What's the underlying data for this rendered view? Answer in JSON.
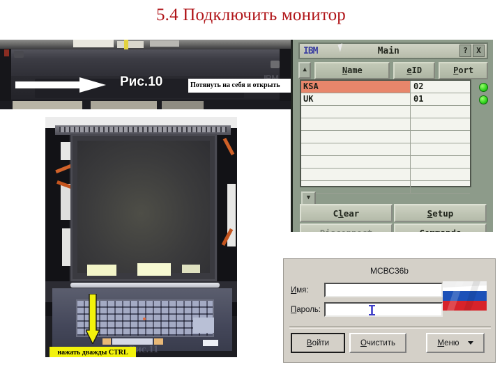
{
  "slide": {
    "title": "5.4 Подключить монитор",
    "title_color": "#b01418"
  },
  "photo_rack": {
    "figure_label": "Рис.10",
    "caption": "Потянуть на себя и открыть",
    "brand_text": "IBM",
    "arrow": "white-right-arrow"
  },
  "photo_monitor": {
    "caption": "нажать дважды CTRL",
    "caption_bg": "#f2f20c",
    "arrow": "yellow-down-arrow",
    "figure_label": "Рис.11"
  },
  "kvm_window": {
    "brand": "IBM",
    "title": "Main",
    "help_button": "?",
    "close_button": "X",
    "scroll_up": "▲",
    "scroll_down": "▼",
    "columns": [
      {
        "label": "Name",
        "accel": "N"
      },
      {
        "label": "eID",
        "accel": "e"
      },
      {
        "label": "Port",
        "accel": "P"
      }
    ],
    "rows": [
      {
        "name": "KSA",
        "eid": "02",
        "status": "online",
        "selected": true
      },
      {
        "name": "UK",
        "eid": "01",
        "status": "online",
        "selected": false
      }
    ],
    "empty_rows": 7,
    "status_color": "#2fd21d",
    "selection_color": "#e8866b",
    "buttons": [
      {
        "label": "Clear",
        "accel": "l",
        "disabled": false
      },
      {
        "label": "Setup",
        "accel": "S",
        "disabled": false
      },
      {
        "label": "Disconnect",
        "accel": "D",
        "disabled": true
      },
      {
        "label": "Commands",
        "accel": "C",
        "disabled": false
      }
    ]
  },
  "login_dialog": {
    "title": "МСВС36b",
    "fields": [
      {
        "label": "Имя:",
        "accel": "И",
        "value": "",
        "focused": false
      },
      {
        "label": "Пароль:",
        "accel": "П",
        "value": "",
        "focused": true
      }
    ],
    "flag": "russia-flag",
    "cursor": "text-ibeam",
    "buttons": [
      {
        "label": "Войти",
        "accel": "В",
        "default": true
      },
      {
        "label": "Очистить",
        "accel": "О",
        "default": false
      },
      {
        "label": "Меню",
        "accel": "М",
        "default": false,
        "has_caret": true
      }
    ]
  }
}
